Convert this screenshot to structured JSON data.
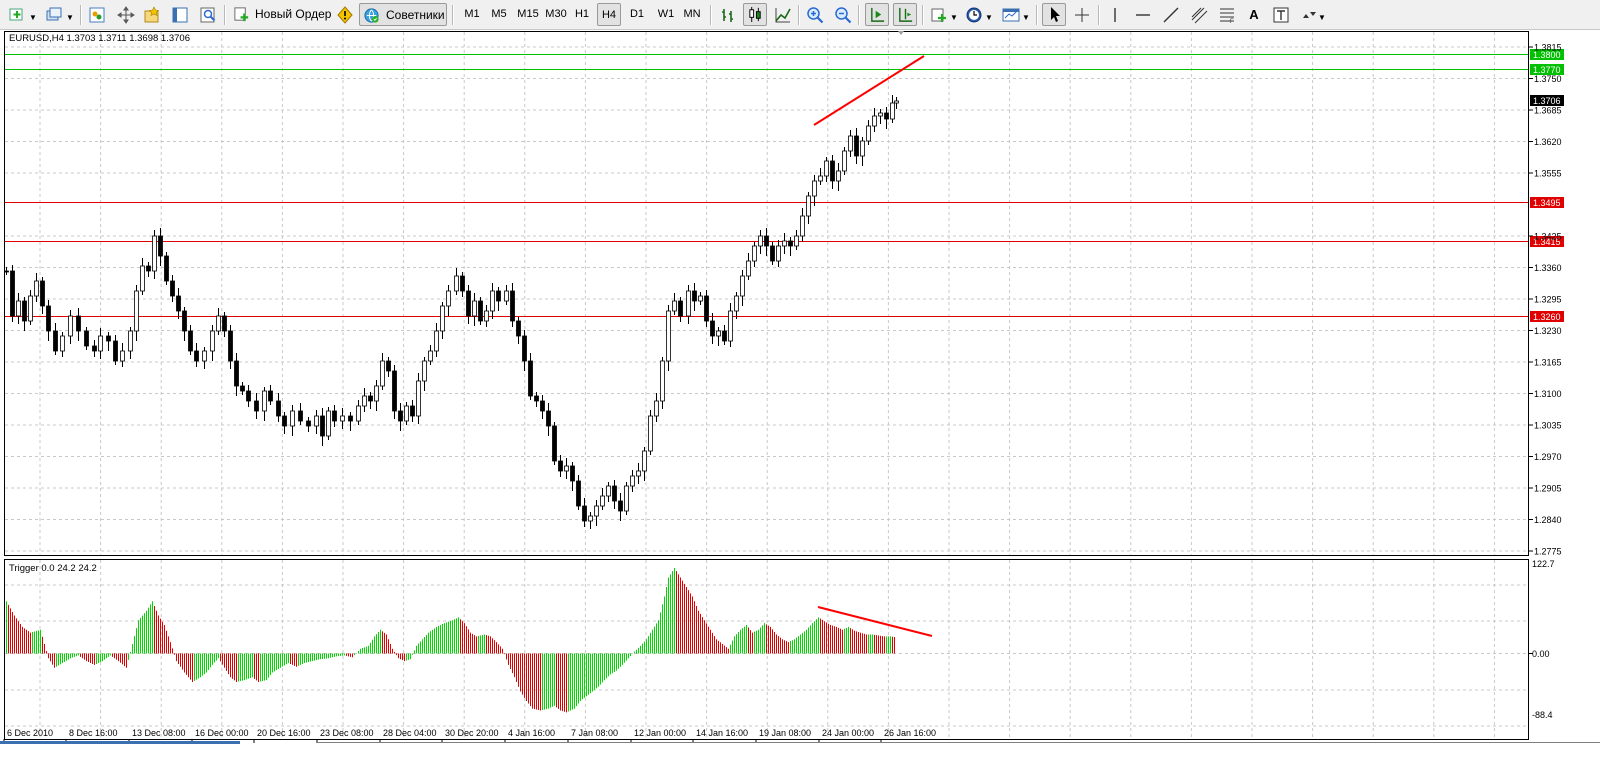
{
  "toolbar": {
    "new_order_label": "Новый Ордер",
    "experts_label": "Советники",
    "timeframes": [
      "M1",
      "M5",
      "M15",
      "M30",
      "H1",
      "H4",
      "D1",
      "W1",
      "MN"
    ],
    "selected_timeframe": "H4",
    "icons": [
      "new-chart-icon",
      "profiles-icon",
      "market-watch-icon",
      "navigator-icon",
      "favorites-icon",
      "data-window-icon",
      "strategy-tester-icon",
      "new-order-icon",
      "alert-icon",
      "experts-icon",
      "bar-chart-icon",
      "candlestick-icon",
      "line-chart-icon",
      "zoom-in-icon",
      "zoom-out-icon",
      "auto-scroll-icon",
      "chart-shift-icon",
      "indicators-icon",
      "periodicity-icon",
      "templates-icon",
      "cursor-icon",
      "crosshair-icon",
      "vertical-line-icon",
      "horizontal-line-icon",
      "trendline-icon",
      "fibonacci-icon",
      "text-icon",
      "text-label-icon",
      "arrows-icon"
    ]
  },
  "main_chart": {
    "title": "EURUSD,H4  1.3703 1.3711 1.3698 1.3706",
    "current_price": "1.3706",
    "price_ticks": [
      "1.3815",
      "1.3750",
      "1.3685",
      "1.3620",
      "1.3555",
      "1.3425",
      "1.3360",
      "1.3295",
      "1.3230",
      "1.3165",
      "1.3100",
      "1.3035",
      "1.2970",
      "1.2905",
      "1.2840",
      "1.2775"
    ],
    "horizontal_levels": [
      {
        "price": 1.38,
        "label": "1.3800",
        "color": "#00c000"
      },
      {
        "price": 1.377,
        "label": "1.3770",
        "color": "#00c000"
      },
      {
        "price": 1.3495,
        "label": "1.3495",
        "color": "#e00000"
      },
      {
        "price": 1.3415,
        "label": "1.3415",
        "color": "#e00000"
      },
      {
        "price": 1.326,
        "label": "1.3260",
        "color": "#e00000"
      }
    ]
  },
  "sub_chart": {
    "title": "Trigger 0.0 24.2 24.2",
    "ticks": [
      "122.7",
      "0.00",
      "-88.4"
    ]
  },
  "time_axis": [
    "6 Dec 2010",
    "8 Dec 16:00",
    "13 Dec 08:00",
    "16 Dec 00:00",
    "20 Dec 16:00",
    "23 Dec 08:00",
    "28 Dec 04:00",
    "30 Dec 20:00",
    "4 Jan 16:00",
    "7 Jan 08:00",
    "12 Jan 00:00",
    "14 Jan 16:00",
    "19 Jan 08:00",
    "24 Jan 00:00",
    "26 Jan 16:00"
  ],
  "colors": {
    "bull_hist": "#00d800",
    "bear_hist": "#e00000",
    "grid": "#c0c0c0",
    "support_line": "#e00000",
    "resistance_line": "#00c000"
  }
}
